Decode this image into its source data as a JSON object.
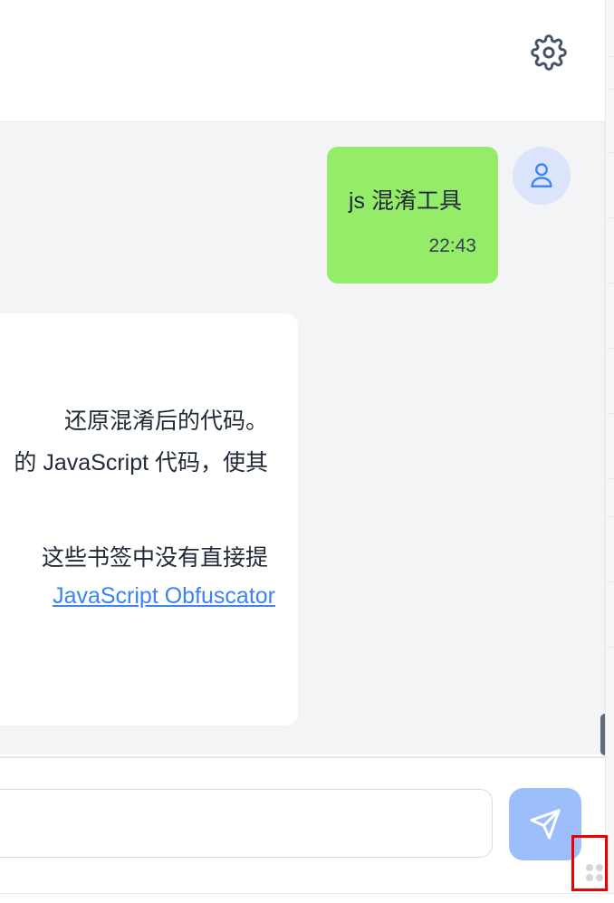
{
  "header": {
    "settings_icon": "gear-icon"
  },
  "messages": {
    "user": {
      "text": "js 混淆工具",
      "time": "22:43",
      "avatar_icon": "user-icon"
    },
    "bot": {
      "lines": [
        "还原混淆后的代码。",
        "的 JavaScript 代码，使其",
        "这些书签中没有直接提"
      ],
      "link": "JavaScript Obfuscator"
    }
  },
  "composer": {
    "input_value": "",
    "send_icon": "send-icon"
  },
  "colors": {
    "user_bubble": "#95ec69",
    "send_button": "#9cbefa",
    "link": "#3b82f6",
    "chat_bg": "#f3f4f6"
  }
}
